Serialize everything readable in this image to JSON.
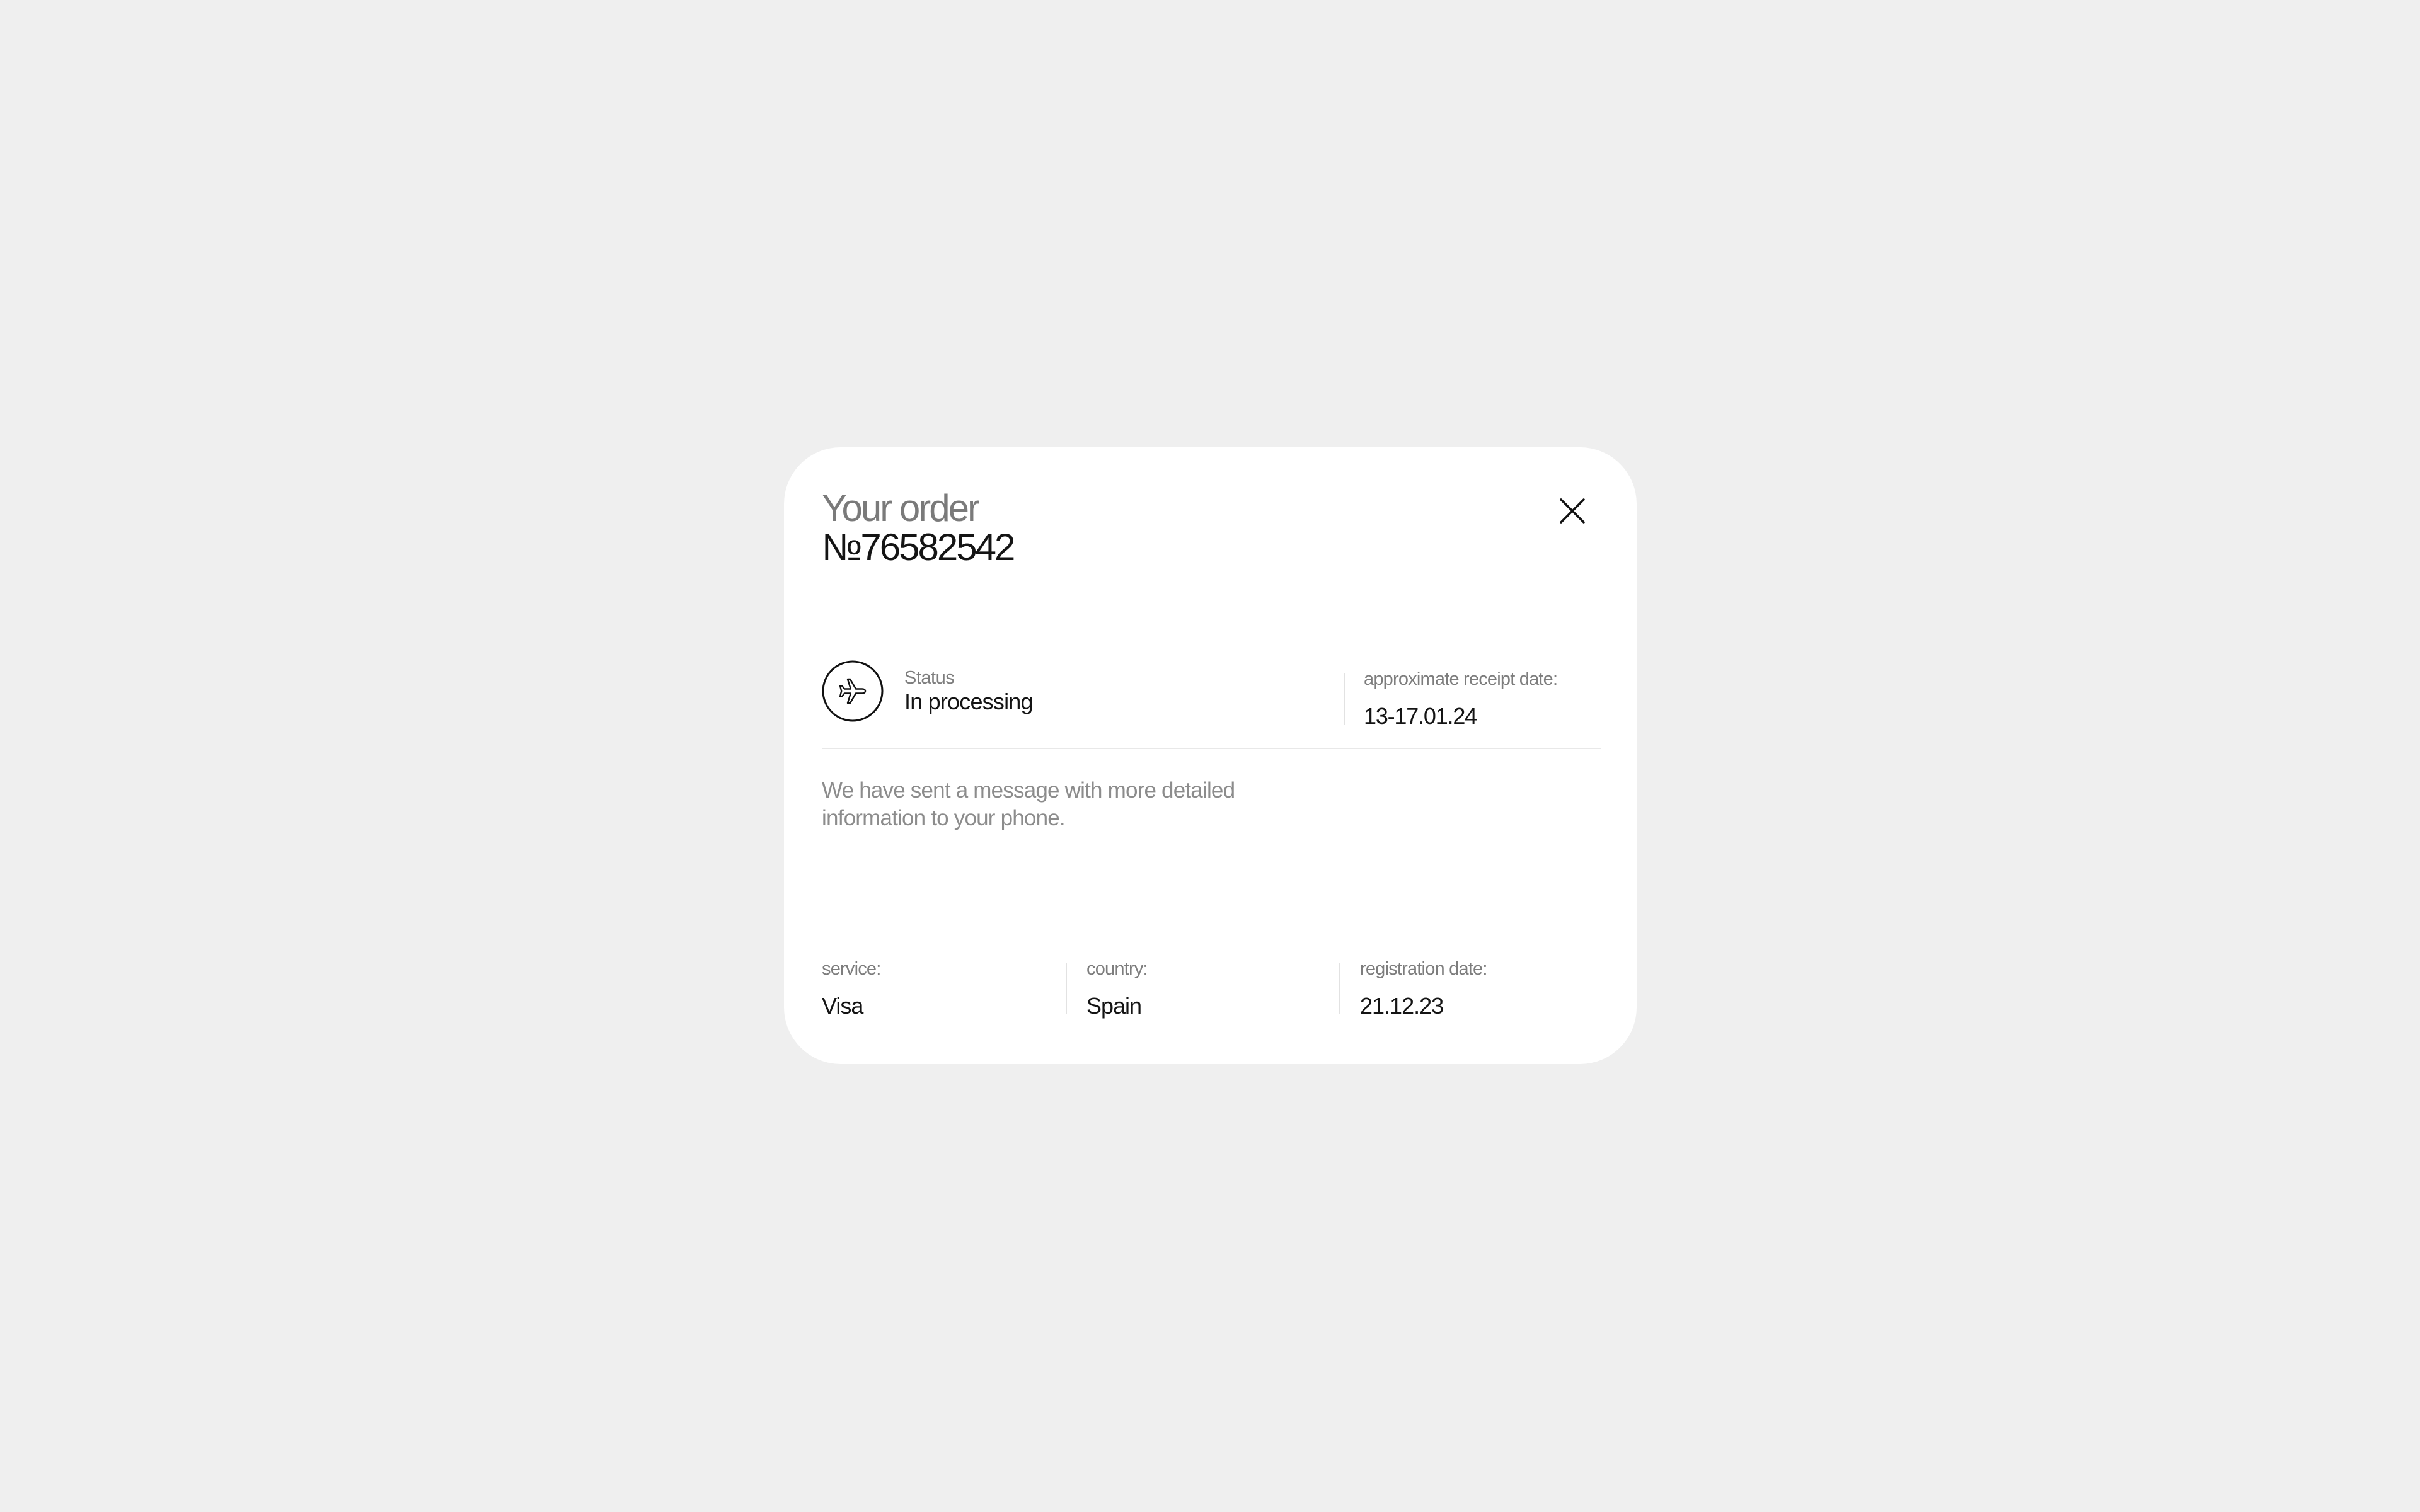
{
  "order": {
    "title": "Your order",
    "number": "№76582542"
  },
  "close": {
    "icon": "close-icon"
  },
  "status": {
    "icon": "airplane-icon",
    "label": "Status",
    "value": "In processing"
  },
  "receipt": {
    "label": "approximate receipt date:",
    "value": "13-17.01.24"
  },
  "message": "We have sent a message with more detailed information to your phone.",
  "details": [
    {
      "label": "service:",
      "value": "Visa"
    },
    {
      "label": "country:",
      "value": "Spain"
    },
    {
      "label": "registration date:",
      "value": "21.12.23"
    }
  ],
  "colors": {
    "background": "#efefef",
    "card": "#ffffff",
    "primary_text": "#141414",
    "muted_text": "#7d7d7d",
    "title_muted": "#7a7a7a",
    "divider": "#e2e2e2"
  }
}
